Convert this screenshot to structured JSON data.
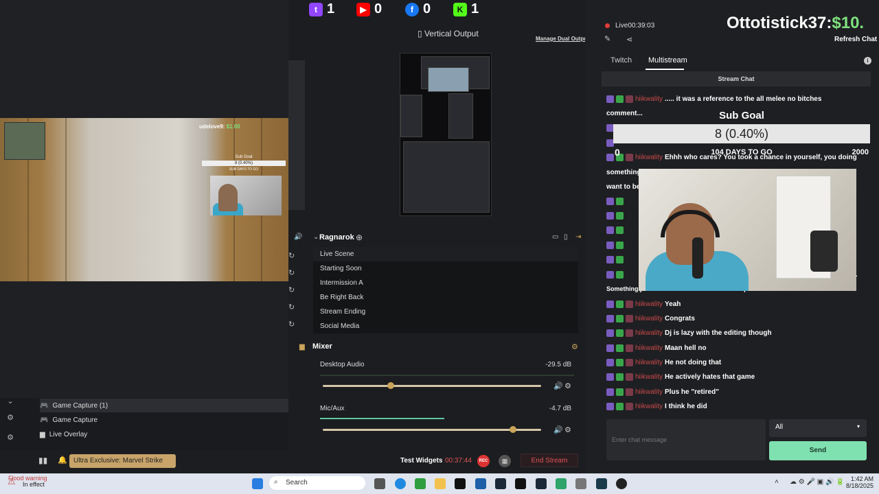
{
  "stats": {
    "twitch": "1",
    "youtube": "0",
    "facebook": "0",
    "kick": "1"
  },
  "preview": {
    "overlay_name": "udelove9:",
    "overlay_amount": "$1.00",
    "sub_goal": "Sub Goal",
    "sub_goal_value": "8 (0.40%)",
    "sub_goal_days": "SUB DAYS TO GO"
  },
  "vertical": {
    "label": "Vertical Output",
    "manage": "Manage Dual Output"
  },
  "scenes": {
    "collection": "Ragnarok",
    "items": [
      "Live Scene",
      "Starting Soon",
      "Intermission A",
      "Be Right Back",
      "Stream Ending",
      "Social Media"
    ],
    "selected": 0
  },
  "mixer": {
    "title": "Mixer",
    "channels": [
      {
        "name": "Desktop Audio",
        "db": "-29.5 dB",
        "level": 0.31
      },
      {
        "name": "Mic/Aux",
        "db": "-4.7 dB",
        "level": 0.87
      }
    ]
  },
  "sources": [
    "Game Capture (1)",
    "Game Capture",
    "Live Overlay"
  ],
  "bottom": {
    "chip": "Ultra Exclusive: Marvel Strike Force",
    "test_widgets": "Test Widgets",
    "timer": "00:37:44",
    "rec": "REC",
    "end_stream": "End Stream"
  },
  "chat": {
    "live_label": "Live",
    "live_time": "00:39:03",
    "overlay_name": "Ottotistick37:",
    "overlay_amount": "$10.",
    "refresh": "Refresh Chat",
    "tabs": [
      "Twitch",
      "Multistream"
    ],
    "header": "Stream Chat",
    "sub_goal": {
      "title": "Sub Goal",
      "value": "8 (0.40%)",
      "days": "104 DAYS TO GO",
      "min": "0",
      "max": "2000"
    },
    "partial_lines": [
      {
        "text": "comment..."
      },
      {
        "text": "something"
      },
      {
        "text": "want to be"
      },
      {
        "text": "Something just don't work out. Like relationships"
      },
      {
        "text": "y."
      }
    ],
    "messages": [
      {
        "user": "hiikwality",
        "text": "..... it was a reference to the all melee no bitches"
      },
      {
        "user": "hiikwality",
        "text": "Ehhh who cares? You took a chance in yourself, you doing"
      },
      {
        "user": "hiikwality",
        "text": "Yeah"
      },
      {
        "user": "hiikwality",
        "text": "Congrats"
      },
      {
        "user": "hiikwality",
        "text": "Dj is lazy with the editing though"
      },
      {
        "user": "hiikwality",
        "text": "Maan hell no"
      },
      {
        "user": "hiikwality",
        "text": "He not doing that"
      },
      {
        "user": "hiikwality",
        "text": "He actively hates that game"
      },
      {
        "user": "hiikwality",
        "text": "Plus he \"retired\""
      },
      {
        "user": "hiikwality",
        "text": "I think he did"
      }
    ],
    "input_placeholder": "Enter chat message",
    "filter": "All",
    "send": "Send"
  },
  "taskbar": {
    "weather_title": "Flood warning",
    "weather_sub": "In effect",
    "search": "Search",
    "time": "1:42 AM",
    "date": "8/18/2025"
  },
  "colors": {
    "accent": "#7fe0b0",
    "live": "#e03c3c",
    "twitch": "#9146ff",
    "youtube": "#ff0000",
    "facebook": "#1877f2",
    "kick": "#53fc18"
  }
}
